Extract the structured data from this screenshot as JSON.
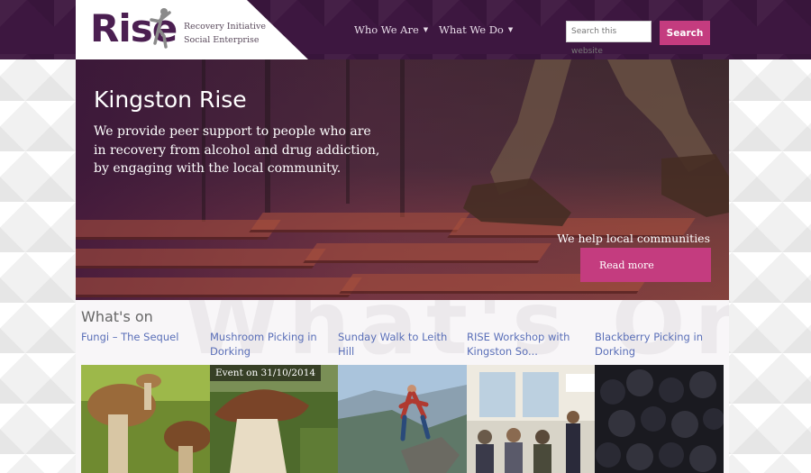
{
  "logo": {
    "word": "Rise",
    "tagline_line1": "Recovery Initiative",
    "tagline_line2": "Social Enterprise"
  },
  "nav": {
    "items": [
      {
        "label": "Who We Are"
      },
      {
        "label": "What We Do"
      }
    ]
  },
  "search": {
    "placeholder": "Search this website",
    "button_label": "Search"
  },
  "hero": {
    "title": "Kingston Rise",
    "text": "We provide peer support to people who are in recovery from alcohol and drug addiction, by engaging with the local community.",
    "cta_text": "We help local communities",
    "cta_button": "Read more"
  },
  "whatson": {
    "title": "What's on",
    "watermark": "What's On",
    "events": [
      {
        "title": "Fungi – The Sequel"
      },
      {
        "title": "Mushroom Picking in Dorking",
        "date": "Event on 31/10/2014"
      },
      {
        "title": "Sunday Walk to Leith Hill"
      },
      {
        "title": "RISE Workshop with Kingston So..."
      },
      {
        "title": "Blackberry Picking in Dorking"
      }
    ]
  },
  "colors": {
    "header_bg": "#3d1740",
    "accent": "#c43c7f",
    "link": "#5a6fb8",
    "logo": "#4b1f51"
  }
}
